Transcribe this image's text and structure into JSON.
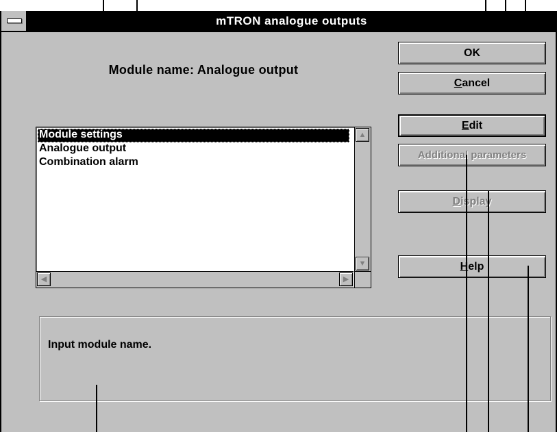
{
  "window": {
    "title": "mTRON analogue outputs"
  },
  "module": {
    "label": "Module name: Analogue output"
  },
  "buttons": {
    "ok": "OK",
    "cancel_mnemonic": "C",
    "cancel_rest": "ancel",
    "edit_mnemonic": "E",
    "edit_rest": "dit",
    "additional_mnemonic": "A",
    "additional_rest": "dditional parameters",
    "display_mnemonic": "D",
    "display_rest": "isplay",
    "help_mnemonic": "H",
    "help_rest": "elp"
  },
  "list": {
    "items": [
      {
        "label": "Module settings",
        "selected": true
      },
      {
        "label": "Analogue output",
        "selected": false
      },
      {
        "label": "Combination alarm",
        "selected": false
      }
    ]
  },
  "info": {
    "text": "Input module name."
  }
}
